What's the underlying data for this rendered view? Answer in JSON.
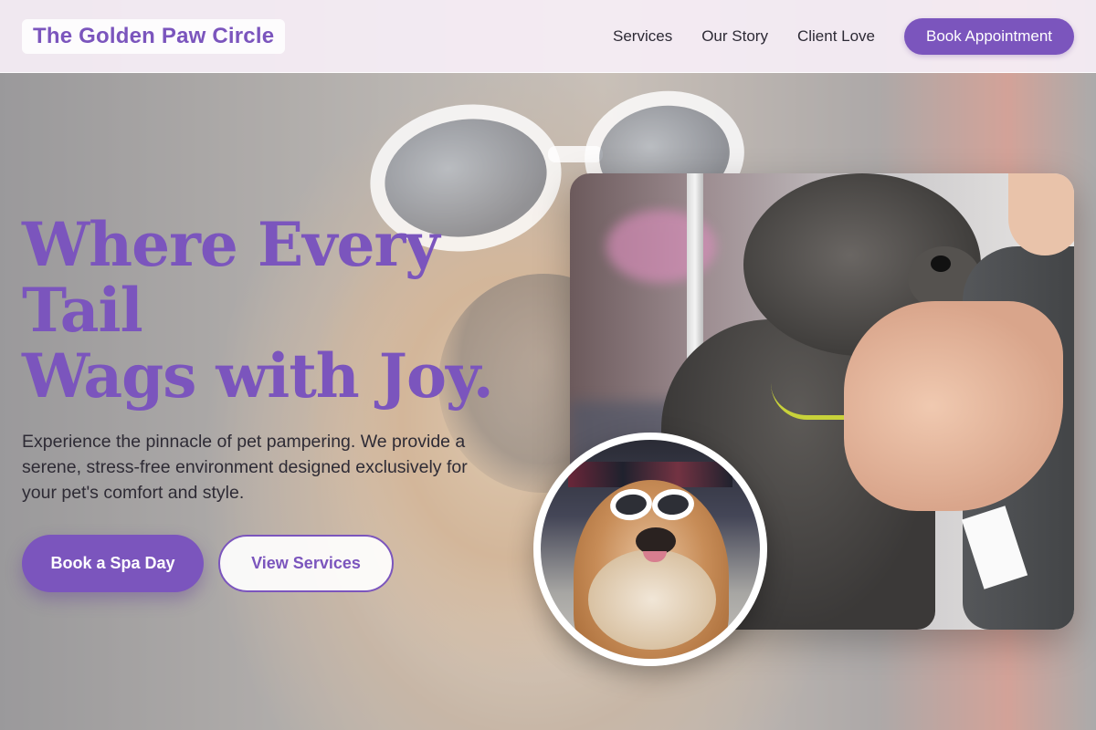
{
  "header": {
    "brand": "The Golden Paw Circle",
    "nav": [
      {
        "label": "Services"
      },
      {
        "label": "Our Story"
      },
      {
        "label": "Client Love"
      }
    ],
    "cta_label": "Book Appointment"
  },
  "hero": {
    "headline_lines": [
      "Where Every",
      "Tail",
      "Wags with Joy."
    ],
    "lede": "Experience the pinnacle of pet pampering. We provide a serene, stress-free environment designed exclusively for your pet's comfort and style.",
    "primary_cta": "Book a Spa Day",
    "secondary_cta": "View Services"
  },
  "colors": {
    "accent": "#7b55bd",
    "header_bg": "#f6eef6",
    "text_dark": "#2e2b35"
  }
}
